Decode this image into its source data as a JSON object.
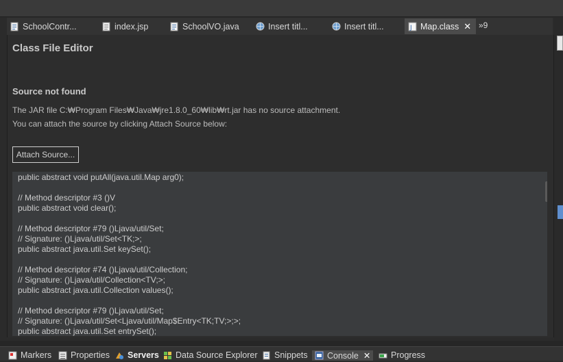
{
  "editor_tabs": [
    {
      "label": "SchoolContr...",
      "icon": "java-source-icon",
      "active": false
    },
    {
      "label": "index.jsp",
      "icon": "jsp-file-icon",
      "active": false
    },
    {
      "label": "SchoolVO.java",
      "icon": "java-source-icon",
      "active": false
    },
    {
      "label": "Insert titl...",
      "icon": "web-browser-icon",
      "active": false
    },
    {
      "label": "Insert titl...",
      "icon": "web-browser-icon",
      "active": false
    },
    {
      "label": "Map.class",
      "icon": "class-file-icon",
      "active": true
    }
  ],
  "overflow_label": "»9",
  "class_editor": {
    "title": "Class File Editor",
    "heading": "Source not found",
    "message_1": "The JAR file C:₩Program Files₩Java₩jre1.8.0_60₩lib₩rt.jar has no source attachment.",
    "message_2": "You can attach the source by clicking Attach Source below:",
    "attach_button": "Attach Source..."
  },
  "code_lines": [
    "public abstract void putAll(java.util.Map arg0);",
    "",
    "// Method descriptor #3 ()V",
    "public abstract void clear();",
    "",
    "// Method descriptor #79 ()Ljava/util/Set;",
    "// Signature: ()Ljava/util/Set<TK;>;",
    "public abstract java.util.Set keySet();",
    "",
    "// Method descriptor #74 ()Ljava/util/Collection;",
    "// Signature: ()Ljava/util/Collection<TV;>;",
    "public abstract java.util.Collection values();",
    "",
    "// Method descriptor #79 ()Ljava/util/Set;",
    "// Signature: ()Ljava/util/Set<Ljava/util/Map$Entry<TK;TV;>;>;",
    "public abstract java.util.Set entrySet();"
  ],
  "bottom_tabs": [
    {
      "label": "Markers",
      "icon": "markers-icon"
    },
    {
      "label": "Properties",
      "icon": "properties-icon"
    },
    {
      "label": "Servers",
      "icon": "servers-icon",
      "bold": true
    },
    {
      "label": "Data Source Explorer",
      "icon": "data-source-icon"
    },
    {
      "label": "Snippets",
      "icon": "snippets-icon"
    },
    {
      "label": "Console",
      "icon": "console-icon",
      "active": true
    },
    {
      "label": "Progress",
      "icon": "progress-icon"
    }
  ],
  "close_glyph": "✕"
}
